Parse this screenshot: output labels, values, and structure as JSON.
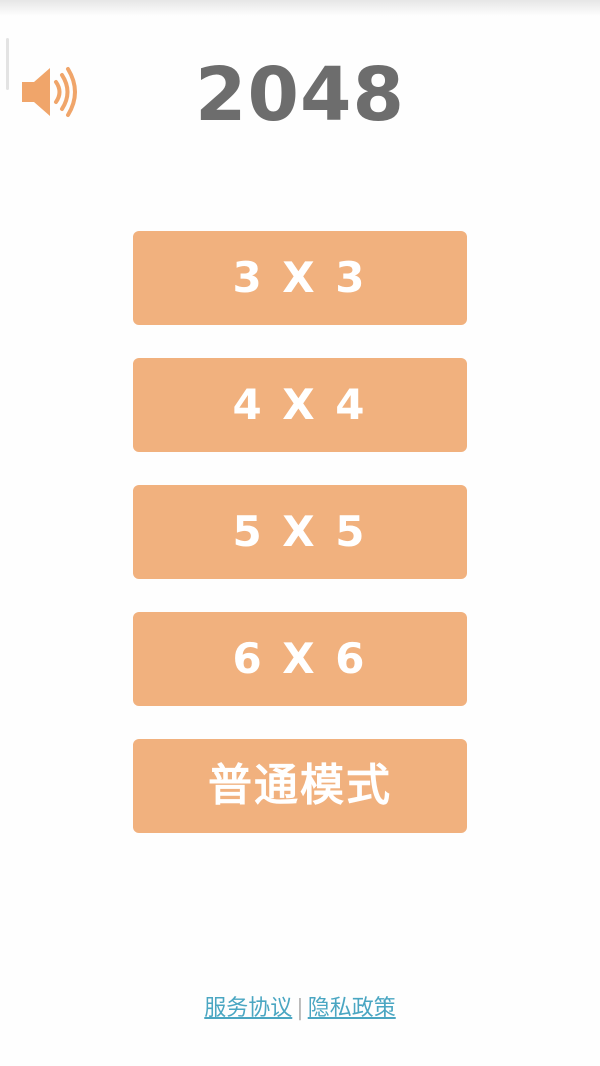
{
  "header": {
    "title": "2048",
    "sound_icon": "speaker-volume-icon",
    "accent_color": "#f0a56a"
  },
  "modes": [
    {
      "label": "3 X 3"
    },
    {
      "label": "4 X 4"
    },
    {
      "label": "5 X 5"
    },
    {
      "label": "6 X 6"
    },
    {
      "label": "普通模式"
    }
  ],
  "colors": {
    "button_bg": "#f1b17e",
    "button_text": "#ffffff",
    "title_text": "#6d6d6d",
    "link": "#4aa6c2"
  },
  "footer": {
    "terms_label": "服务协议",
    "separator": "|",
    "privacy_label": "隐私政策"
  }
}
